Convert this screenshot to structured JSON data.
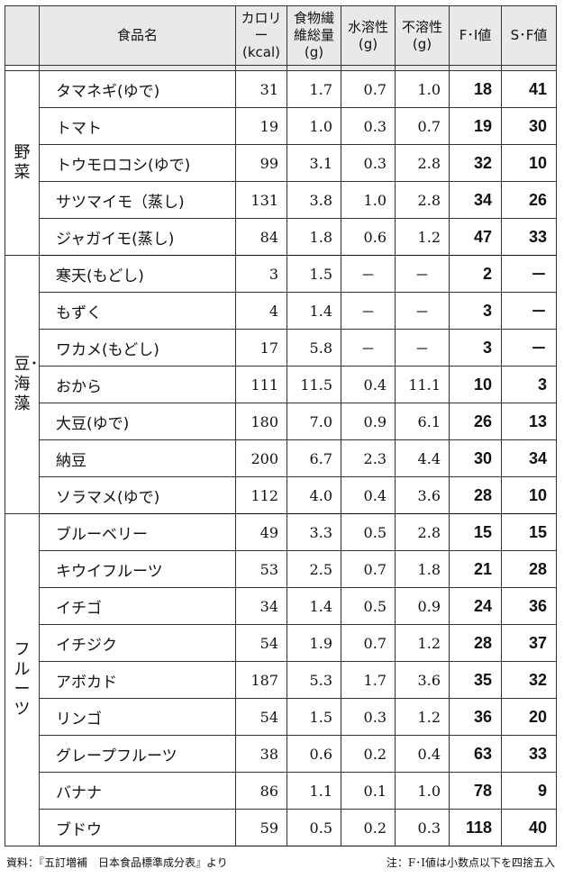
{
  "headers": {
    "group": "",
    "name": "食品名",
    "calorie": "カロリー(kcal)",
    "fiber": "食物繊維総量(g)",
    "soluble": "水溶性(g)",
    "insoluble": "不溶性(g)",
    "fi": "F･I値",
    "sf": "S･F値"
  },
  "groups": [
    {
      "label": "野菜",
      "rows": [
        {
          "name": "タマネギ(ゆで)",
          "calorie": "31",
          "fiber": "1.7",
          "soluble": "0.7",
          "insoluble": "1.0",
          "fi": "18",
          "sf": "41"
        },
        {
          "name": "トマト",
          "calorie": "19",
          "fiber": "1.0",
          "soluble": "0.3",
          "insoluble": "0.7",
          "fi": "19",
          "sf": "30"
        },
        {
          "name": "トウモロコシ(ゆで)",
          "calorie": "99",
          "fiber": "3.1",
          "soluble": "0.3",
          "insoluble": "2.8",
          "fi": "32",
          "sf": "10"
        },
        {
          "name": "サツマイモ（蒸し)",
          "calorie": "131",
          "fiber": "3.8",
          "soluble": "1.0",
          "insoluble": "2.8",
          "fi": "34",
          "sf": "26"
        },
        {
          "name": "ジャガイモ(蒸し)",
          "calorie": "84",
          "fiber": "1.8",
          "soluble": "0.6",
          "insoluble": "1.2",
          "fi": "47",
          "sf": "33"
        }
      ]
    },
    {
      "label": "豆･海藻",
      "rows": [
        {
          "name": "寒天(もどし)",
          "calorie": "3",
          "fiber": "1.5",
          "soluble": "－",
          "insoluble": "－",
          "fi": "2",
          "sf": "－"
        },
        {
          "name": "もずく",
          "calorie": "4",
          "fiber": "1.4",
          "soluble": "－",
          "insoluble": "－",
          "fi": "3",
          "sf": "－"
        },
        {
          "name": "ワカメ(もどし)",
          "calorie": "17",
          "fiber": "5.8",
          "soluble": "－",
          "insoluble": "－",
          "fi": "3",
          "sf": "－"
        },
        {
          "name": "おから",
          "calorie": "111",
          "fiber": "11.5",
          "soluble": "0.4",
          "insoluble": "11.1",
          "fi": "10",
          "sf": "3"
        },
        {
          "name": "大豆(ゆで)",
          "calorie": "180",
          "fiber": "7.0",
          "soluble": "0.9",
          "insoluble": "6.1",
          "fi": "26",
          "sf": "13"
        },
        {
          "name": "納豆",
          "calorie": "200",
          "fiber": "6.7",
          "soluble": "2.3",
          "insoluble": "4.4",
          "fi": "30",
          "sf": "34"
        },
        {
          "name": "ソラマメ(ゆで)",
          "calorie": "112",
          "fiber": "4.0",
          "soluble": "0.4",
          "insoluble": "3.6",
          "fi": "28",
          "sf": "10"
        }
      ]
    },
    {
      "label": "フルーツ",
      "rows": [
        {
          "name": "ブルーベリー",
          "calorie": "49",
          "fiber": "3.3",
          "soluble": "0.5",
          "insoluble": "2.8",
          "fi": "15",
          "sf": "15"
        },
        {
          "name": "キウイフルーツ",
          "calorie": "53",
          "fiber": "2.5",
          "soluble": "0.7",
          "insoluble": "1.8",
          "fi": "21",
          "sf": "28"
        },
        {
          "name": "イチゴ",
          "calorie": "34",
          "fiber": "1.4",
          "soluble": "0.5",
          "insoluble": "0.9",
          "fi": "24",
          "sf": "36"
        },
        {
          "name": "イチジク",
          "calorie": "54",
          "fiber": "1.9",
          "soluble": "0.7",
          "insoluble": "1.2",
          "fi": "28",
          "sf": "37"
        },
        {
          "name": "アボカド",
          "calorie": "187",
          "fiber": "5.3",
          "soluble": "1.7",
          "insoluble": "3.6",
          "fi": "35",
          "sf": "32"
        },
        {
          "name": "リンゴ",
          "calorie": "54",
          "fiber": "1.5",
          "soluble": "0.3",
          "insoluble": "1.2",
          "fi": "36",
          "sf": "20"
        },
        {
          "name": "グレープフルーツ",
          "calorie": "38",
          "fiber": "0.6",
          "soluble": "0.2",
          "insoluble": "0.4",
          "fi": "63",
          "sf": "33"
        },
        {
          "name": "バナナ",
          "calorie": "86",
          "fiber": "1.1",
          "soluble": "0.1",
          "insoluble": "1.0",
          "fi": "78",
          "sf": "9"
        },
        {
          "name": "ブドウ",
          "calorie": "59",
          "fiber": "0.5",
          "soluble": "0.2",
          "insoluble": "0.3",
          "fi": "118",
          "sf": "40"
        }
      ]
    }
  ],
  "footer": {
    "source": "資料：『五訂増補　日本食品標準成分表』より",
    "note": "注：F･I値は小数点以下を四捨五入"
  }
}
